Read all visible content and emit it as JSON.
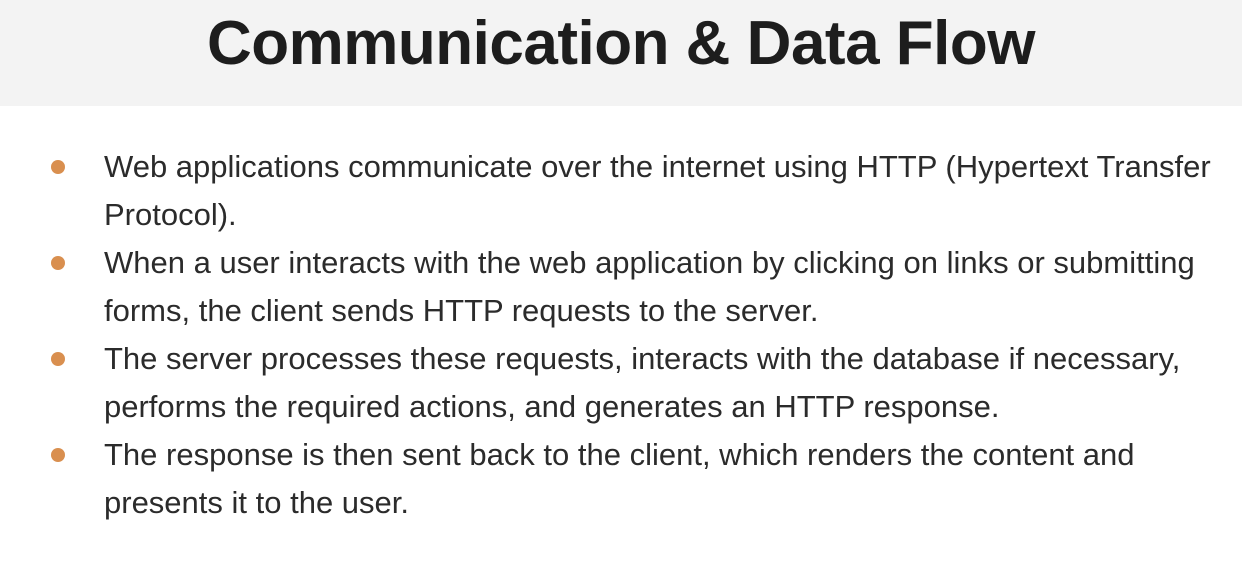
{
  "slide": {
    "title": "Communication & Data Flow",
    "bullet_color": "#d98f4f",
    "bullets": [
      "Web applications communicate over the internet using HTTP (Hypertext Transfer Protocol).",
      "When a user interacts with the web application by clicking on links or submitting forms, the client sends HTTP requests to the server.",
      "The server processes these requests, interacts with the database if necessary, performs the required actions, and generates an HTTP response.",
      "The response is then sent back to the client, which renders the content and presents it to the user."
    ]
  }
}
